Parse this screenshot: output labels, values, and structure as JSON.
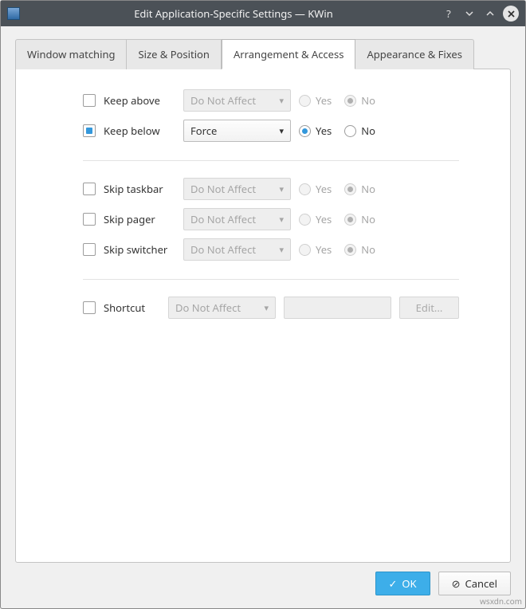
{
  "window": {
    "title": "Edit Application-Specific Settings — KWin"
  },
  "tabs": [
    {
      "label": "Window matching"
    },
    {
      "label": "Size & Position"
    },
    {
      "label": "Arrangement & Access",
      "active": true
    },
    {
      "label": "Appearance & Fixes"
    }
  ],
  "common": {
    "do_not_affect": "Do Not Affect",
    "yes": "Yes",
    "no": "No"
  },
  "rules": {
    "keep_above": {
      "label": "Keep above",
      "checked": false,
      "mode": "Do Not Affect",
      "value": "no"
    },
    "keep_below": {
      "label": "Keep below",
      "checked": true,
      "mode": "Force",
      "value": "yes"
    },
    "skip_taskbar": {
      "label": "Skip taskbar",
      "checked": false,
      "mode": "Do Not Affect",
      "value": "no"
    },
    "skip_pager": {
      "label": "Skip pager",
      "checked": false,
      "mode": "Do Not Affect",
      "value": "no"
    },
    "skip_switcher": {
      "label": "Skip switcher",
      "checked": false,
      "mode": "Do Not Affect",
      "value": "no"
    },
    "shortcut": {
      "label": "Shortcut",
      "checked": false,
      "mode": "Do Not Affect",
      "edit": "Edit..."
    }
  },
  "buttons": {
    "ok": "OK",
    "cancel": "Cancel"
  },
  "watermark": "wsxdn.com"
}
